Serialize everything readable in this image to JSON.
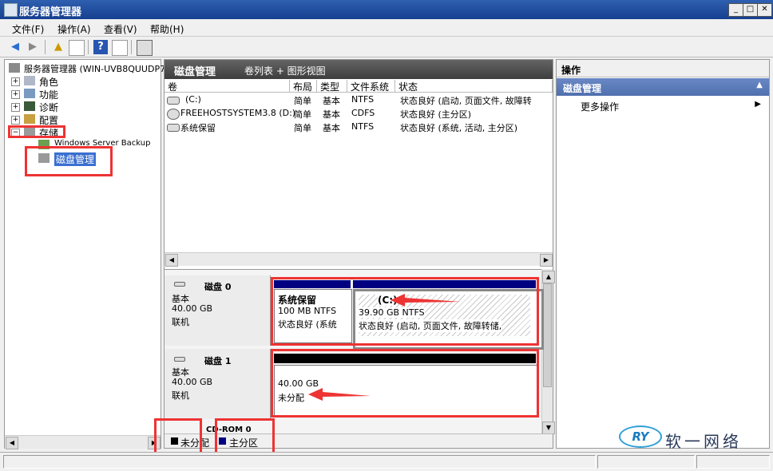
{
  "window": {
    "title": "服务器管理器"
  },
  "menu": [
    "文件(F)",
    "操作(A)",
    "查看(V)",
    "帮助(H)"
  ],
  "tree": {
    "root": "服务器管理器 (WIN-UVB8QUUDP7",
    "items": [
      "角色",
      "功能",
      "诊断",
      "配置",
      "存储"
    ],
    "storage_children": [
      "Windows Server Backup",
      "磁盘管理"
    ]
  },
  "center": {
    "header_title": "磁盘管理",
    "header_view": "卷列表 + 图形视图",
    "columns": [
      "卷",
      "布局",
      "类型",
      "文件系统",
      "状态"
    ],
    "rows": [
      {
        "vol": "(C:)",
        "layout": "简单",
        "type": "基本",
        "fs": "NTFS",
        "status": "状态良好 (启动, 页面文件, 故障转"
      },
      {
        "vol": "FREEHOSTSYSTEM3.8 (D:)",
        "layout": "简单",
        "type": "基本",
        "fs": "CDFS",
        "status": "状态良好 (主分区)"
      },
      {
        "vol": "系统保留",
        "layout": "简单",
        "type": "基本",
        "fs": "NTFS",
        "status": "状态良好 (系统, 活动, 主分区)"
      }
    ]
  },
  "disks": [
    {
      "name": "磁盘 0",
      "kind": "基本",
      "size": "40.00 GB",
      "state": "联机",
      "partitions": [
        {
          "title": "系统保留",
          "size": "100 MB NTFS",
          "status": "状态良好 (系统"
        },
        {
          "title": "(C:)",
          "size": "39.90 GB NTFS",
          "status": "状态良好 (启动, 页面文件, 故障转储,"
        }
      ]
    },
    {
      "name": "磁盘 1",
      "kind": "基本",
      "size": "40.00 GB",
      "state": "联机",
      "partitions": [
        {
          "size": "40.00 GB",
          "status": "未分配"
        }
      ]
    }
  ],
  "cdrom": {
    "name": "CD-ROM 0"
  },
  "legend": {
    "unallocated": "未分配",
    "primary": "主分区"
  },
  "actions": {
    "header": "操作",
    "section": "磁盘管理",
    "more": "更多操作"
  },
  "watermark": {
    "text": "软一网络",
    "logo": "RY"
  },
  "colors": {
    "primary_partition": "#000080",
    "unallocated": "#000000",
    "highlight": "#e33333",
    "header_dark": "#4a4a4a",
    "action_header": "#5a7ab8"
  }
}
